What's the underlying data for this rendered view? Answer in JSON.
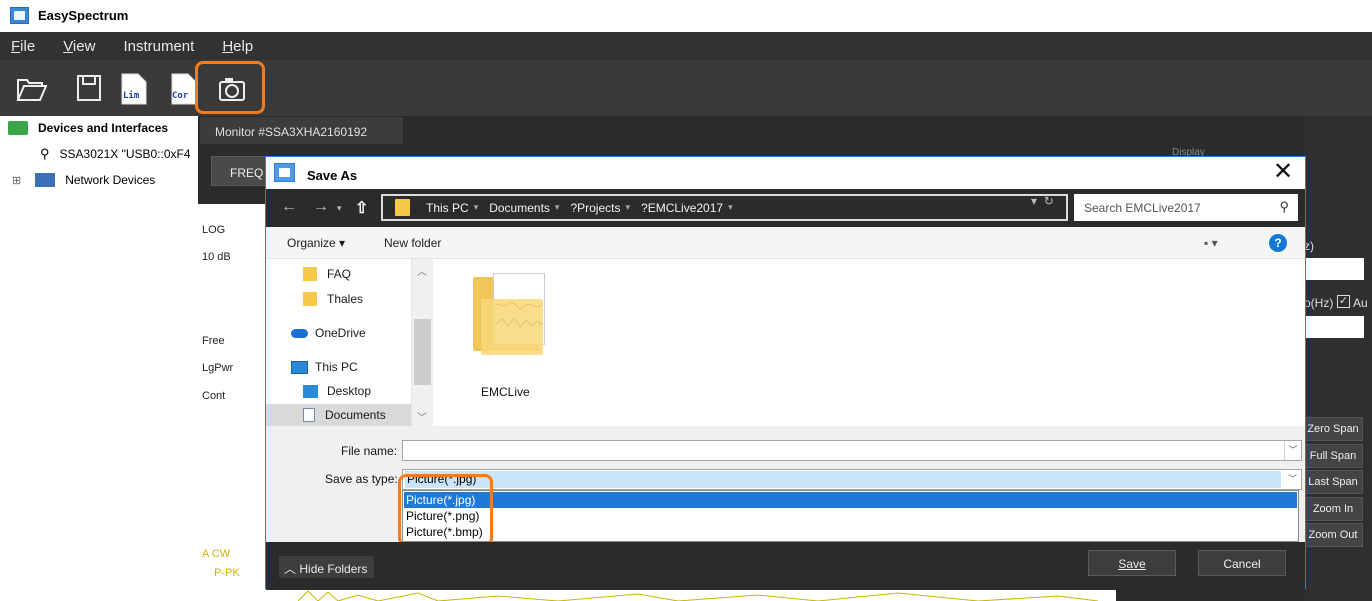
{
  "app": {
    "title": "EasySpectrum"
  },
  "menu": [
    "File",
    "View",
    "Instrument",
    "Help"
  ],
  "toolbar": {
    "buttons": [
      "open-icon",
      "save-icon",
      "lim-icon",
      "cor-icon",
      "camera-icon"
    ],
    "lim_label": "Lim",
    "cor_label": "Cor"
  },
  "tree": {
    "root": "Devices and Interfaces",
    "device": "SSA3021X \"USB0::0xF4",
    "network": "Network Devices",
    "expand": "⊞"
  },
  "monitor": {
    "tab": "Monitor #SSA3XHA2160192",
    "freq": "FREQ",
    "display_label": "Display",
    "labels_left": [
      "LOG",
      "10 dB",
      "Free",
      "LgPwr",
      "Cont"
    ],
    "labels_green": [
      "A CW",
      "P-PK"
    ]
  },
  "right_panel": {
    "hz_label": "z)",
    "span_label": "o(Hz)",
    "auto_label": "Au",
    "buttons": [
      "Zero Span",
      "Full Span",
      "Last Span",
      "Zoom In",
      "Zoom Out"
    ]
  },
  "dialog": {
    "title": "Save As",
    "close": "✕",
    "breadcrumbs": [
      "This PC",
      "Documents",
      "?Projects",
      "?EMCLive2017"
    ],
    "search_placeholder": "Search EMCLive2017",
    "organize": "Organize ▾",
    "new_folder": "New folder",
    "help": "?",
    "view_menu": "▪ ▾",
    "nav_items": [
      "FAQ",
      "Thales",
      "OneDrive",
      "This PC",
      "Desktop",
      "Documents"
    ],
    "folder": "EMCLive",
    "file_name_label": "File name:",
    "file_name_value": "",
    "save_type_label": "Save as type:",
    "save_type_value": "Picture(*.jpg)",
    "type_options": [
      "Picture(*.jpg)",
      "Picture(*.png)",
      "Picture(*.bmp)"
    ],
    "hide_folders": "Hide Folders",
    "save": "Save",
    "cancel": "Cancel"
  },
  "colors": {
    "accent": "#f07c22",
    "selection": "#1e7ad6",
    "window_border": "#2f7dd6"
  }
}
